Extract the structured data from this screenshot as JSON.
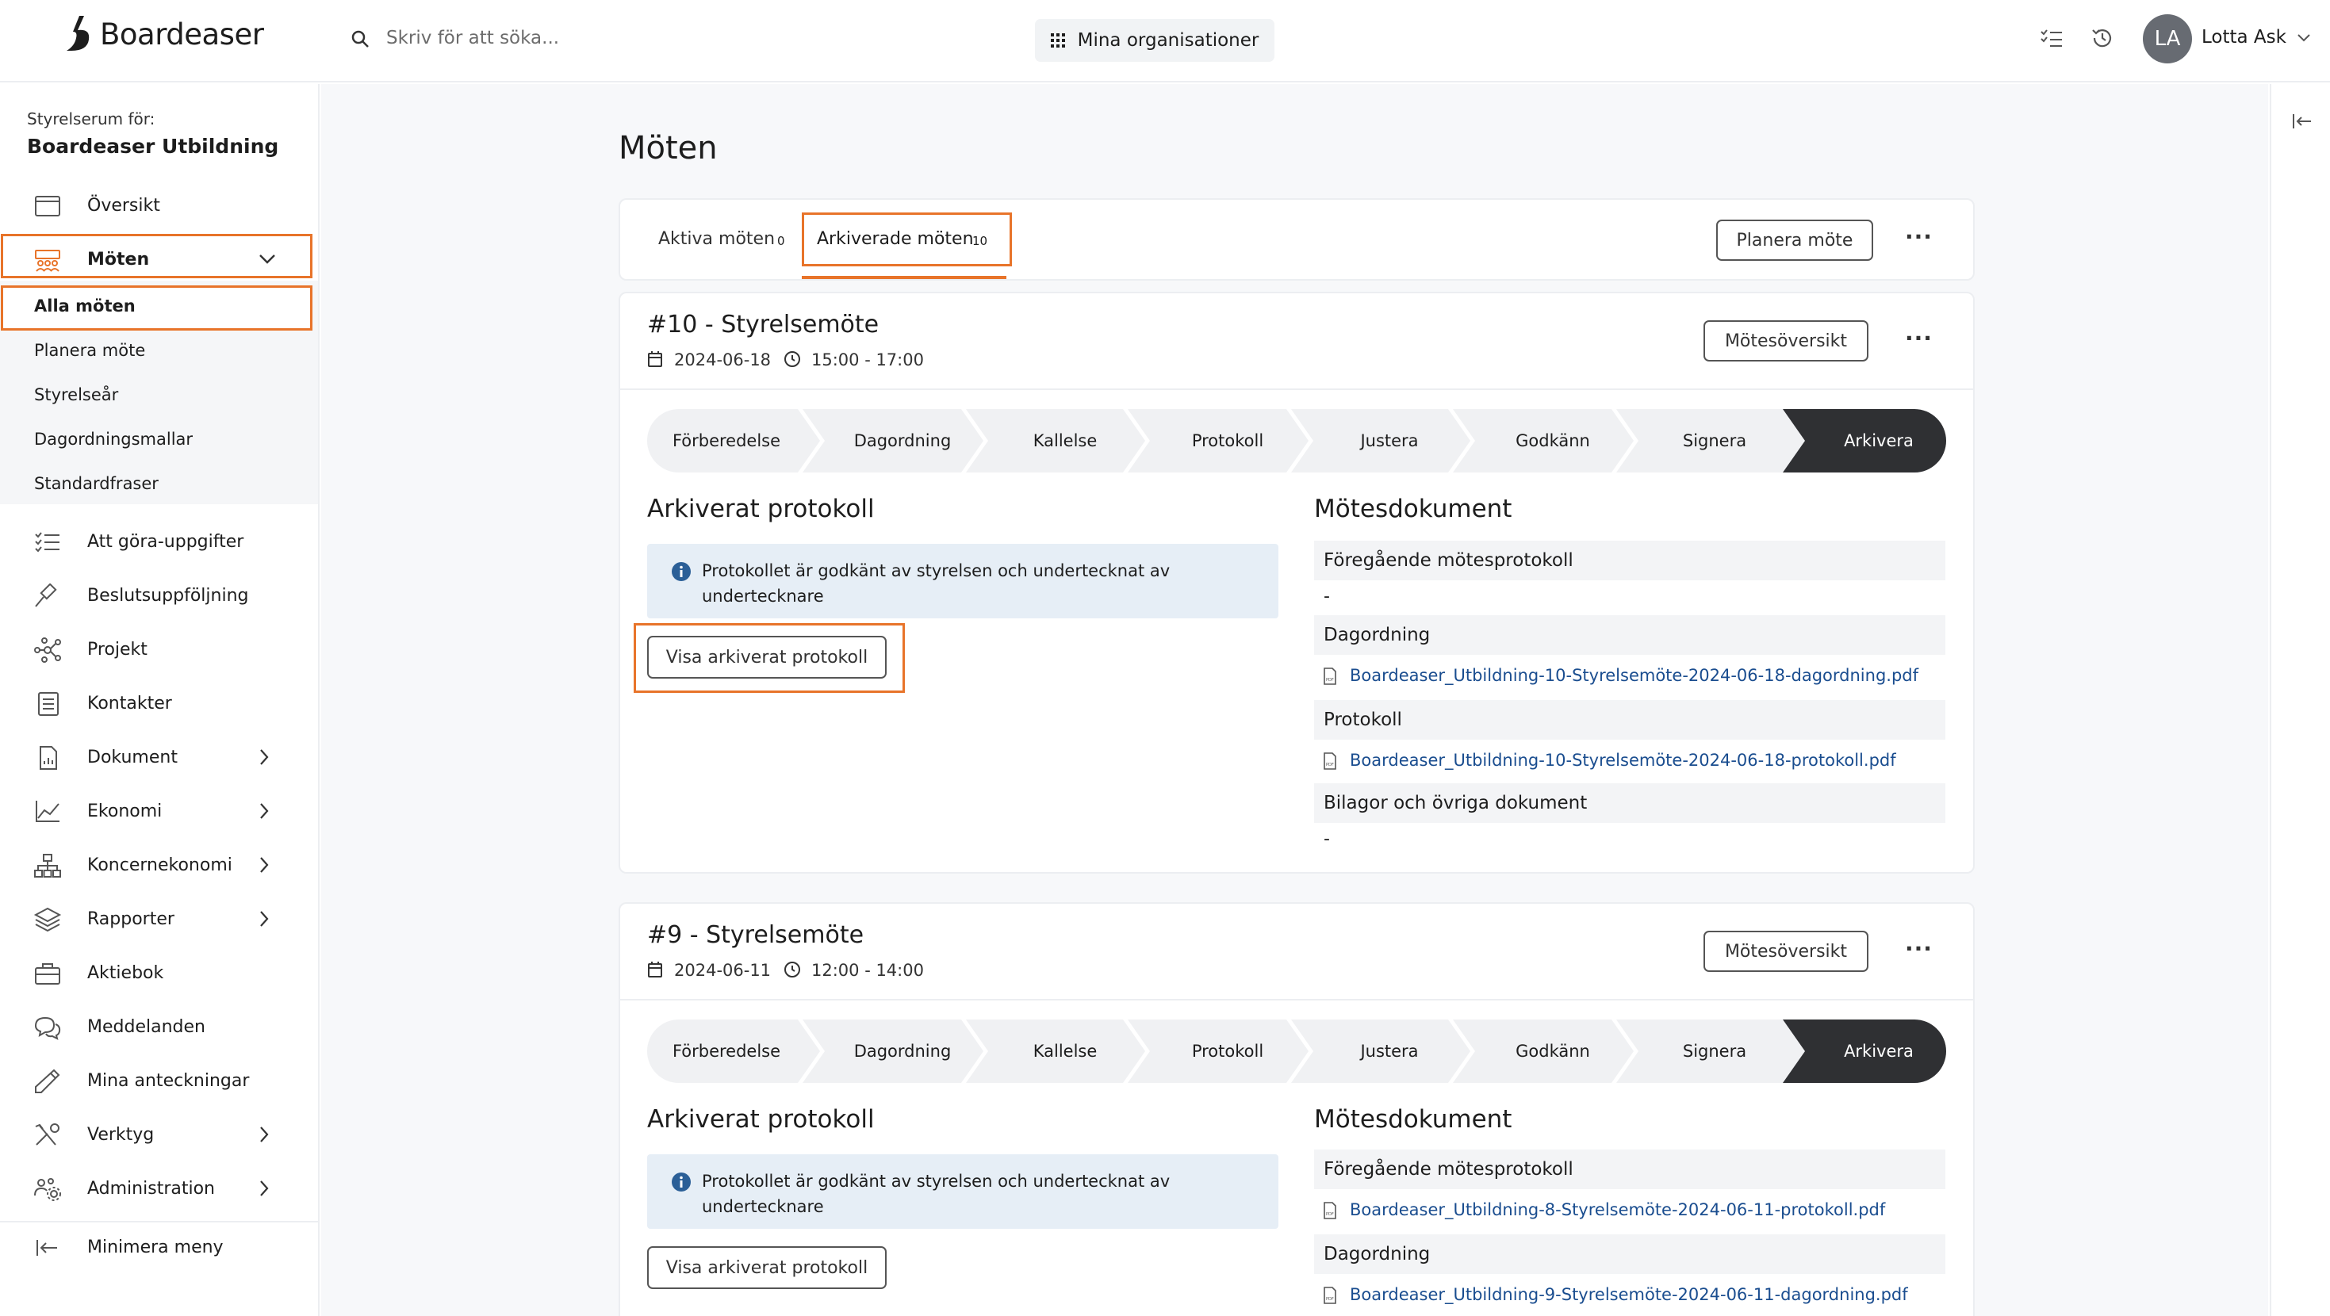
{
  "header": {
    "logo_text": "Boardeaser",
    "search_placeholder": "Skriv för att söka...",
    "org_button": "Mina organisationer",
    "avatar_initials": "LA",
    "user_name": "Lotta Ask"
  },
  "sidebar": {
    "caption": "Styrelserum för:",
    "org_name": "Boardeaser Utbildning",
    "items": [
      {
        "label": "Översikt",
        "icon": "calendar-window-icon"
      },
      {
        "label": "Möten",
        "icon": "meeting-icon"
      },
      {
        "label": "Att göra-uppgifter",
        "icon": "checklist-icon"
      },
      {
        "label": "Beslutsuppföljning",
        "icon": "gavel-icon"
      },
      {
        "label": "Projekt",
        "icon": "network-icon"
      },
      {
        "label": "Kontakter",
        "icon": "address-book-icon"
      },
      {
        "label": "Dokument",
        "icon": "document-icon"
      },
      {
        "label": "Ekonomi",
        "icon": "line-chart-icon"
      },
      {
        "label": "Koncernekonomi",
        "icon": "org-chart-icon"
      },
      {
        "label": "Rapporter",
        "icon": "layers-icon"
      },
      {
        "label": "Aktiebok",
        "icon": "briefcase-icon"
      },
      {
        "label": "Meddelanden",
        "icon": "chat-icon"
      },
      {
        "label": "Mina anteckningar",
        "icon": "pencil-icon"
      },
      {
        "label": "Verktyg",
        "icon": "tools-icon"
      },
      {
        "label": "Administration",
        "icon": "users-gear-icon"
      }
    ],
    "sub_items": [
      "Alla möten",
      "Planera möte",
      "Styrelseår",
      "Dagordningsmallar",
      "Standardfraser"
    ],
    "minimize": "Minimera meny"
  },
  "main": {
    "title": "Möten",
    "tabs": [
      {
        "label": "Aktiva möten",
        "count": "0"
      },
      {
        "label": "Arkiverade möten",
        "count": "10"
      }
    ],
    "plan_button": "Planera möte",
    "steps": [
      "Förberedelse",
      "Dagordning",
      "Kallelse",
      "Protokoll",
      "Justera",
      "Godkänn",
      "Signera",
      "Arkivera"
    ],
    "meetings": [
      {
        "title": "#10 - Styrelsemöte",
        "date": "2024-06-18",
        "time": "15:00 - 17:00",
        "overview_button": "Mötesöversikt",
        "archived_title": "Arkiverat protokoll",
        "info_line1": "Protokollet är godkänt av styrelsen och undertecknat av",
        "info_line2": "undertecknare",
        "view_button": "Visa arkiverat protokoll",
        "docs_title": "Mötesdokument",
        "prev_protocol_heading": "Föregående mötesprotokoll",
        "prev_protocol_value": "-",
        "agenda_heading": "Dagordning",
        "agenda_file": "Boardeaser_Utbildning-10-Styrelsemöte-2024-06-18-dagordning.pdf",
        "protocol_heading": "Protokoll",
        "protocol_file": "Boardeaser_Utbildning-10-Styrelsemöte-2024-06-18-protokoll.pdf",
        "attachments_heading": "Bilagor och övriga dokument",
        "attachments_value": "-"
      },
      {
        "title": "#9 - Styrelsemöte",
        "date": "2024-06-11",
        "time": "12:00 - 14:00",
        "overview_button": "Mötesöversikt",
        "archived_title": "Arkiverat protokoll",
        "info_line1": "Protokollet är godkänt av styrelsen och undertecknat av",
        "info_line2": "undertecknare",
        "view_button": "Visa arkiverat protokoll",
        "docs_title": "Mötesdokument",
        "prev_protocol_heading": "Föregående mötesprotokoll",
        "prev_protocol_file": "Boardeaser_Utbildning-8-Styrelsemöte-2024-06-11-protokoll.pdf",
        "agenda_heading": "Dagordning",
        "agenda_file": "Boardeaser_Utbildning-9-Styrelsemöte-2024-06-11-dagordning.pdf"
      }
    ]
  },
  "colors": {
    "highlight": "#e8742a",
    "link": "#1a4d8f",
    "active_step": "#2f3033",
    "info_bg": "#e6eef6",
    "info_icon": "#2b5f97"
  }
}
